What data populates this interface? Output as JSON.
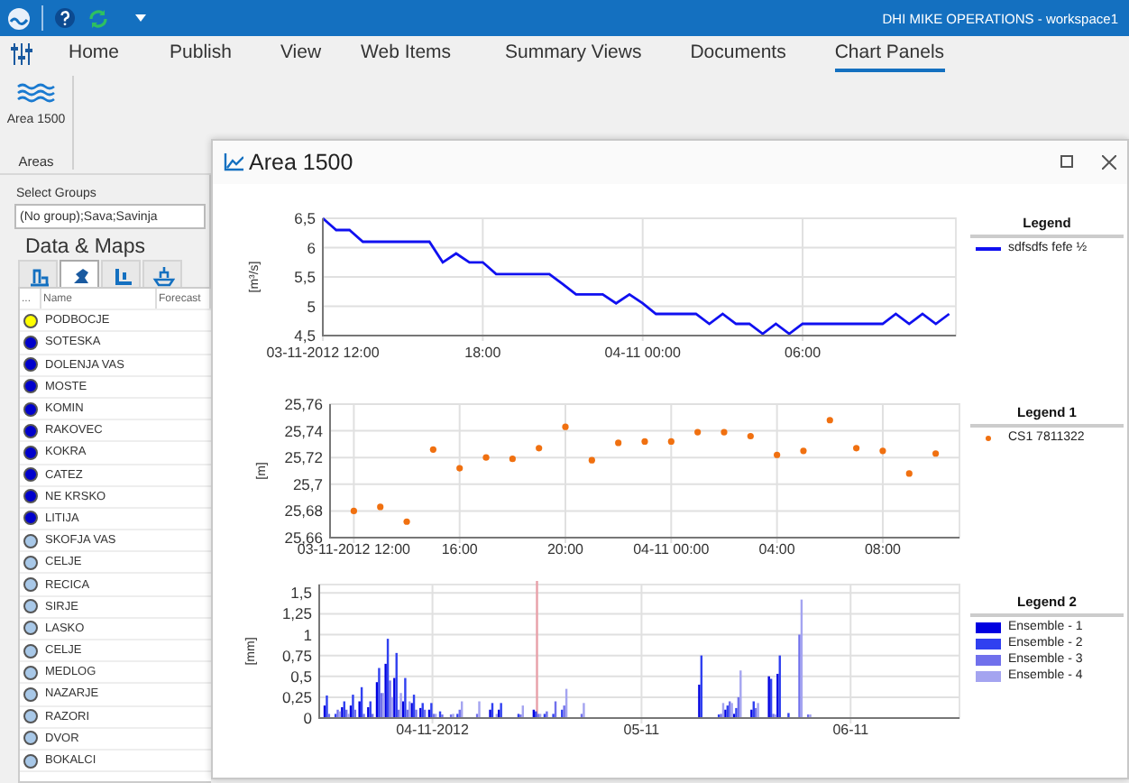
{
  "title_bar": {
    "title": "DHI MIKE OPERATIONS - workspace1"
  },
  "ribbon": {
    "tabs": [
      {
        "label": "Home",
        "selected": false
      },
      {
        "label": "Publish",
        "selected": false
      },
      {
        "label": "View",
        "selected": false
      },
      {
        "label": "Web Items",
        "selected": false
      },
      {
        "label": "Summary Views",
        "selected": false
      },
      {
        "label": "Documents",
        "selected": false
      },
      {
        "label": "Chart Panels",
        "selected": true
      }
    ],
    "groups": [
      {
        "label": "Areas",
        "buttons": [
          {
            "label": "Area 1500"
          }
        ]
      }
    ]
  },
  "left_panel": {
    "select_groups": {
      "label": "Select Groups",
      "value": "(No group);Sava;Savinja"
    },
    "heading": "Data & Maps",
    "view_tabs": [
      {
        "selected": false
      },
      {
        "selected": true
      },
      {
        "selected": false
      },
      {
        "selected": false
      }
    ],
    "table": {
      "columns": [
        "...",
        "Name",
        "Forecast"
      ],
      "rows": [
        {
          "name": "PODBOCJE",
          "color": "#ffff00"
        },
        {
          "name": "SOTESKA",
          "color": "#0000cc"
        },
        {
          "name": "DOLENJA VAS",
          "color": "#0000cc"
        },
        {
          "name": "MOSTE",
          "color": "#0000cc"
        },
        {
          "name": "KOMIN",
          "color": "#0000cc"
        },
        {
          "name": "RAKOVEC",
          "color": "#0000cc"
        },
        {
          "name": "KOKRA",
          "color": "#0000cc"
        },
        {
          "name": "CATEZ",
          "color": "#0000cc"
        },
        {
          "name": "NE KRSKO",
          "color": "#0000cc"
        },
        {
          "name": "LITIJA",
          "color": "#0000cc"
        },
        {
          "name": "SKOFJA VAS",
          "color": "#a8c8e8"
        },
        {
          "name": "CELJE",
          "color": "#a8c8e8"
        },
        {
          "name": "RECICA",
          "color": "#a8c8e8"
        },
        {
          "name": "SIRJE",
          "color": "#a8c8e8"
        },
        {
          "name": "LASKO",
          "color": "#a8c8e8"
        },
        {
          "name": "CELJE",
          "color": "#a8c8e8"
        },
        {
          "name": "MEDLOG",
          "color": "#a8c8e8"
        },
        {
          "name": "NAZARJE",
          "color": "#a8c8e8"
        },
        {
          "name": "RAZORI",
          "color": "#a8c8e8"
        },
        {
          "name": "DVOR",
          "color": "#a8c8e8"
        },
        {
          "name": "BOKALCI",
          "color": "#a8c8e8"
        }
      ]
    }
  },
  "chart_window": {
    "title": "Area 1500",
    "charts": [
      {
        "legend_title": "Legend",
        "chart_data": {
          "type": "line",
          "grid": true,
          "ylabel": "[m³/s]",
          "ylim": [
            4.5,
            6.5
          ],
          "yticks": [
            {
              "value": 4.5,
              "label": "4,5"
            },
            {
              "value": 5,
              "label": "5"
            },
            {
              "value": 5.5,
              "label": "5,5"
            },
            {
              "value": 6,
              "label": "6"
            },
            {
              "value": 6.5,
              "label": "6,5"
            }
          ],
          "categories": [
            "03-11-2012 12:00",
            null,
            null,
            null,
            null,
            null,
            null,
            null,
            null,
            null,
            null,
            null,
            "18:00",
            null,
            null,
            null,
            null,
            null,
            null,
            null,
            null,
            null,
            null,
            null,
            "04-11 00:00",
            null,
            null,
            null,
            null,
            null,
            null,
            null,
            null,
            null,
            null,
            null,
            "06:00",
            null,
            null,
            null,
            null,
            null,
            null,
            null,
            null,
            null,
            null,
            null
          ],
          "series": [
            {
              "name": "sdfsdfs fefe ½",
              "color": "#1010f0",
              "values": [
                6.5,
                6.3,
                6.3,
                6.1,
                6.1,
                6.1,
                6.1,
                6.1,
                6.1,
                5.75,
                5.9,
                5.75,
                5.75,
                5.55,
                5.55,
                5.55,
                5.55,
                5.55,
                5.38,
                5.2,
                5.2,
                5.2,
                5.05,
                5.2,
                5.05,
                4.87,
                4.87,
                4.87,
                4.87,
                4.7,
                4.87,
                4.7,
                4.7,
                4.53,
                4.7,
                4.53,
                4.7,
                4.7,
                4.7,
                4.7,
                4.7,
                4.7,
                4.7,
                4.87,
                4.7,
                4.87,
                4.7,
                4.87
              ]
            }
          ]
        }
      },
      {
        "legend_title": "Legend 1",
        "chart_data": {
          "type": "scatter",
          "grid": true,
          "ylabel": "[m]",
          "ylim": [
            25.66,
            25.76
          ],
          "yticks": [
            {
              "value": 25.66,
              "label": "25,66"
            },
            {
              "value": 25.68,
              "label": "25,68"
            },
            {
              "value": 25.7,
              "label": "25,7"
            },
            {
              "value": 25.72,
              "label": "25,72"
            },
            {
              "value": 25.74,
              "label": "25,74"
            },
            {
              "value": 25.76,
              "label": "25,76"
            }
          ],
          "categories": [
            "03-11-2012 12:00",
            null,
            null,
            null,
            "16:00",
            null,
            null,
            null,
            "20:00",
            null,
            null,
            null,
            "04-11 00:00",
            null,
            null,
            null,
            "04:00",
            null,
            null,
            null,
            "08:00",
            null,
            null
          ],
          "series": [
            {
              "name": "CS1 7811322",
              "color": "#f07010",
              "values": [
                25.68,
                25.683,
                25.672,
                25.726,
                25.712,
                25.72,
                25.719,
                25.727,
                25.743,
                25.718,
                25.731,
                25.732,
                25.732,
                25.739,
                25.739,
                25.736,
                25.722,
                25.725,
                25.748,
                25.727,
                25.725,
                25.708,
                25.723
              ]
            }
          ]
        }
      },
      {
        "legend_title": "Legend 2",
        "chart_data": {
          "type": "bar",
          "ylabel": "[mm]",
          "ylim": [
            0,
            1.6
          ],
          "yticks": [
            {
              "value": 0,
              "label": "0"
            },
            {
              "value": 0.25,
              "label": "0,25"
            },
            {
              "value": 0.5,
              "label": "0,5"
            },
            {
              "value": 0.75,
              "label": "0,75"
            },
            {
              "value": 1,
              "label": "1"
            },
            {
              "value": 1.25,
              "label": "1,25"
            },
            {
              "value": 1.5,
              "label": "1,5"
            }
          ],
          "categories": [
            null,
            null,
            null,
            null,
            null,
            null,
            null,
            null,
            null,
            null,
            null,
            null,
            "04-11-2012",
            null,
            null,
            null,
            null,
            null,
            null,
            null,
            null,
            null,
            null,
            null,
            null,
            null,
            null,
            null,
            null,
            null,
            null,
            null,
            null,
            null,
            null,
            null,
            "05-11",
            null,
            null,
            null,
            null,
            null,
            null,
            null,
            null,
            null,
            null,
            null,
            null,
            null,
            null,
            null,
            null,
            null,
            null,
            null,
            null,
            null,
            null,
            null,
            "06-11"
          ],
          "series": [
            {
              "name": "Ensemble - 1",
              "color": "#0000e0",
              "values": [
                0.15,
                0,
                0.13,
                0.15,
                0.2,
                0.13,
                0.43,
                0.65,
                0.48,
                0.2,
                0.18,
                0.12,
                0.1,
                0,
                0,
                0,
                0,
                0,
                0,
                0.1,
                0.1,
                0,
                0,
                0,
                0.1,
                0,
                0,
                0,
                0,
                0,
                0,
                0,
                0,
                0,
                0,
                0,
                0,
                0,
                0,
                0,
                0,
                0,
                0,
                0.4,
                0,
                0,
                0.1,
                0.05,
                0,
                0.1,
                0,
                0.5,
                0.53,
                0,
                0,
                0,
                null,
                null,
                null,
                null,
                null
              ]
            },
            {
              "name": "Ensemble - 2",
              "color": "#3040f0",
              "values": [
                0.27,
                0.05,
                0.2,
                0.28,
                0.37,
                0.2,
                0.6,
                0.95,
                0.78,
                0.48,
                0.28,
                0.18,
                0.18,
                0.08,
                0,
                0.05,
                0,
                0,
                0,
                0.18,
                0.18,
                0,
                0.05,
                0,
                0.08,
                0.05,
                0.05,
                0.1,
                0,
                0,
                0,
                0,
                0,
                0,
                0,
                0,
                0,
                0,
                0,
                0,
                0,
                0,
                0,
                0.75,
                0,
                0.03,
                0.15,
                0.12,
                0,
                0.2,
                0,
                0.47,
                0.75,
                0.06,
                0,
                0,
                null,
                null,
                null,
                null,
                null
              ]
            },
            {
              "name": "Ensemble - 3",
              "color": "#7070ec",
              "values": [
                0.05,
                0.1,
                0.1,
                0.1,
                0.05,
                0.05,
                0.3,
                0.45,
                0.1,
                0.1,
                0.1,
                0.1,
                0.05,
                0.02,
                0.02,
                0.1,
                0,
                0.05,
                0,
                0,
                0,
                0,
                0.02,
                0,
                0.05,
                0.08,
                0.2,
                0.15,
                0,
                0.05,
                0,
                0,
                0,
                0,
                0,
                0,
                0,
                0,
                0,
                0,
                0,
                0,
                0,
                0,
                0,
                0.05,
                0.2,
                0.25,
                0,
                0.12,
                0,
                0.05,
                0,
                0,
                1.0,
                0.02,
                null,
                null,
                null,
                null,
                null
              ]
            },
            {
              "name": "Ensemble - 4",
              "color": "#a4a4f0",
              "values": [
                0,
                0.08,
                0.05,
                0,
                0,
                0,
                0.3,
                0.25,
                0.3,
                0.2,
                0,
                0,
                0.05,
                0,
                0.05,
                0.2,
                0,
                0.2,
                0,
                0.05,
                0,
                0,
                0.15,
                0,
                0.05,
                0,
                0,
                0.35,
                0,
                0.18,
                0,
                0,
                0,
                0,
                0,
                0,
                0,
                0,
                0,
                0,
                0,
                0,
                0,
                0,
                0,
                0.18,
                0.18,
                0.57,
                0,
                0.18,
                0,
                0.03,
                0,
                0,
                1.42,
                0.02,
                null,
                null,
                null,
                null,
                null
              ]
            }
          ],
          "grid": true
        }
      }
    ]
  }
}
